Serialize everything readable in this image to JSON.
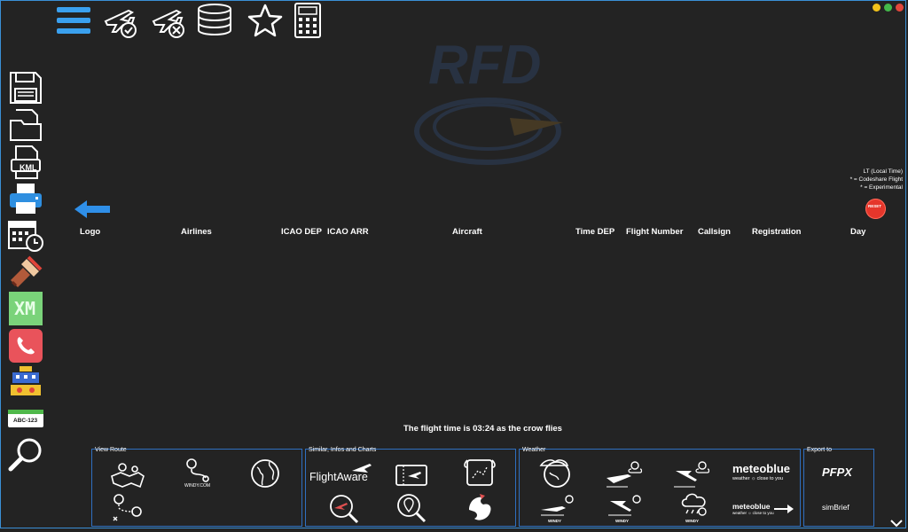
{
  "window": {
    "controls": [
      "minimize",
      "maximize",
      "close"
    ]
  },
  "toolbar": {
    "icons": [
      "menu-icon",
      "flight-confirmed-icon",
      "flight-cancelled-icon",
      "database-icon",
      "star-icon",
      "calculator-icon"
    ]
  },
  "sidebar": {
    "icons": [
      "save-icon",
      "open-folder-icon",
      "kml-file-icon",
      "print-icon",
      "calendar-clock-icon",
      "paint-brush-icon",
      "xm-icon",
      "phone-icon",
      "vehicle-icon",
      "plate-icon",
      "search-icon"
    ],
    "kml_label": "KML",
    "xm_label": "XM",
    "plate_label": "ABC-123"
  },
  "watermark": {
    "text": "RFD"
  },
  "legend": {
    "line1": "LT (Local Time)",
    "line2": "* = Codeshare Flight",
    "line3": "* = Experimental"
  },
  "reset_button": {
    "label": "RESET"
  },
  "table": {
    "headers": {
      "logo": "Logo",
      "airlines": "Airlines",
      "icao_dep": "ICAO DEP",
      "icao_arr": "ICAO ARR",
      "aircraft": "Aircraft",
      "time_dep": "Time DEP",
      "flight_number": "Flight Number",
      "callsign": "Callsign",
      "registration": "Registration",
      "day": "Day"
    }
  },
  "flight_time_text": "The flight time is 03:24 as the crow flies",
  "panels": {
    "view_route": {
      "title": "View Route",
      "windy_label": "WINDY.COM"
    },
    "similar": {
      "title": "Similar, Infos and Charts",
      "flightaware_label": "FlightAware"
    },
    "weather": {
      "title": "Weather",
      "meteoblue": "meteoblue",
      "meteoblue_tag": "weather ☼ close to you",
      "windy": "WINDY"
    },
    "export": {
      "title": "Export to",
      "pfpx": "PFPX",
      "simbrief": "simBrief"
    }
  },
  "colors": {
    "background": "#232323",
    "accent": "#2f7fd6",
    "panel_border": "#2f6fc0"
  }
}
